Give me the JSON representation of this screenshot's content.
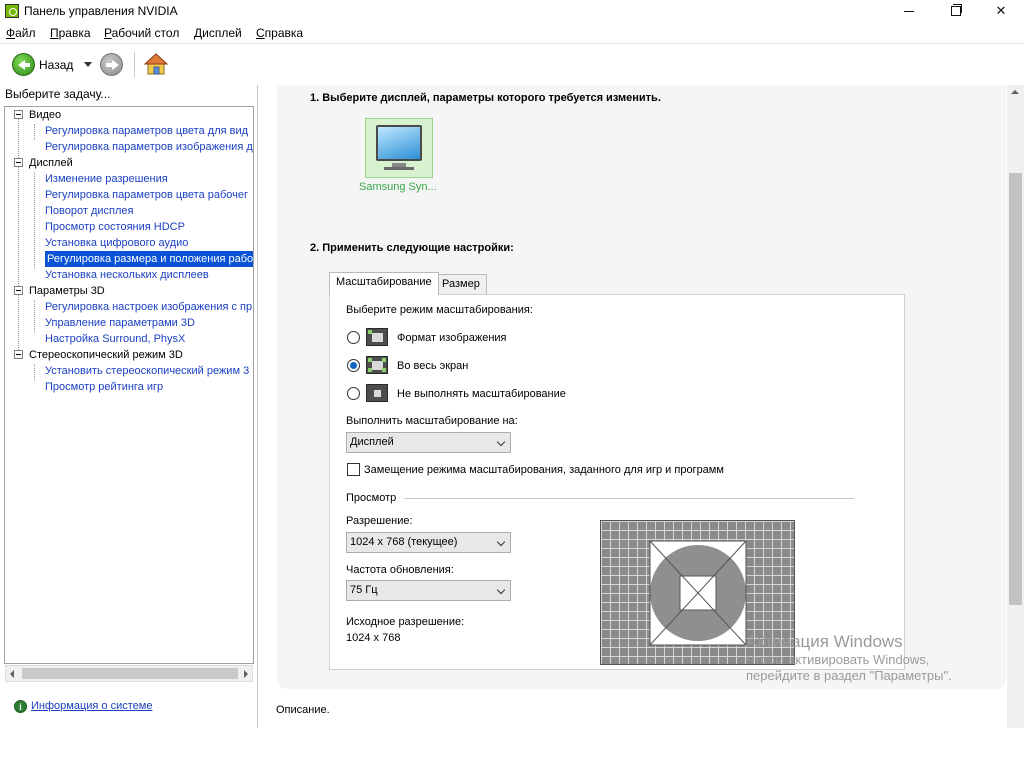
{
  "window": {
    "title": "Панель управления NVIDIA"
  },
  "menu": [
    "Файл",
    "Правка",
    "Рабочий стол",
    "Дисплей",
    "Справка"
  ],
  "toolbar": {
    "back_label": "Назад"
  },
  "left": {
    "header": "Выберите задачу...",
    "tree": [
      {
        "label": "Видео",
        "items": [
          "Регулировка параметров цвета для вид",
          "Регулировка параметров изображения д"
        ]
      },
      {
        "label": "Дисплей",
        "items": [
          "Изменение разрешения",
          "Регулировка параметров цвета рабочег",
          "Поворот дисплея",
          "Просмотр состояния HDCP",
          "Установка цифрового аудио",
          "Регулировка размера и положения рабо",
          "Установка нескольких дисплеев"
        ]
      },
      {
        "label": "Параметры 3D",
        "items": [
          "Регулировка настроек изображения с пр",
          "Управление параметрами 3D",
          "Настройка Surround, PhysX"
        ]
      },
      {
        "label": "Стереоскопический режим 3D",
        "items": [
          "Установить стереоскопический режим 3",
          "Просмотр рейтинга игр"
        ]
      }
    ],
    "selected_item": "Регулировка размера и положения рабо",
    "sysinfo_link": "Информация о системе"
  },
  "main": {
    "section1_title": "1. Выберите дисплей, параметры которого требуется изменить.",
    "display_name": "Samsung Syn...",
    "section2_title": "2. Применить следующие настройки:",
    "tabs": [
      "Масштабирование",
      "Размер"
    ],
    "active_tab": "Масштабирование",
    "scaling_mode_label": "Выберите режим масштабирования:",
    "scaling_modes": [
      {
        "label": "Формат изображения",
        "checked": false
      },
      {
        "label": "Во весь экран",
        "checked": true
      },
      {
        "label": "Не выполнять масштабирование",
        "checked": false
      }
    ],
    "perform_on_label": "Выполнить масштабирование на:",
    "perform_on_value": "Дисплей",
    "override_label": "Замещение режима масштабирования, заданного для игр и программ",
    "override_checked": false,
    "preview_group": "Просмотр",
    "resolution_label": "Разрешение:",
    "resolution_value": "1024 x 768 (текущее)",
    "refresh_label": "Частота обновления:",
    "refresh_value": "75 Гц",
    "native_label": "Исходное разрешение:",
    "native_value": "1024 x 768",
    "description_label": "Описание."
  },
  "watermark": {
    "title": "Активация Windows",
    "line1": "Чтобы активировать Windows,",
    "line2": "перейдите в раздел \"Параметры\"."
  },
  "colors": {
    "accent_green": "#76b900",
    "selection_blue": "#0a52d6",
    "link_blue": "#1a3fc2",
    "display_label_green": "#3aa84a"
  }
}
